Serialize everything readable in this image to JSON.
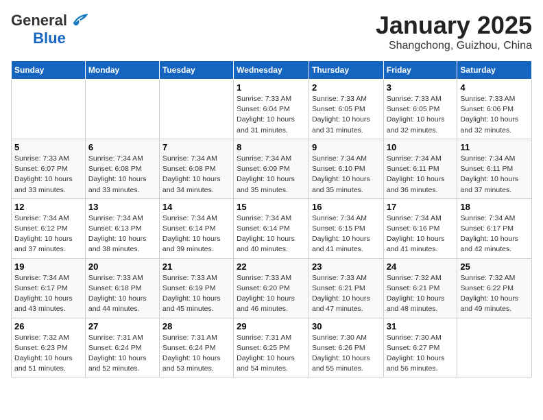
{
  "header": {
    "logo_general": "General",
    "logo_blue": "Blue",
    "month": "January 2025",
    "location": "Shangchong, Guizhou, China"
  },
  "days_of_week": [
    "Sunday",
    "Monday",
    "Tuesday",
    "Wednesday",
    "Thursday",
    "Friday",
    "Saturday"
  ],
  "weeks": [
    [
      {
        "day": "",
        "info": ""
      },
      {
        "day": "",
        "info": ""
      },
      {
        "day": "",
        "info": ""
      },
      {
        "day": "1",
        "info": "Sunrise: 7:33 AM\nSunset: 6:04 PM\nDaylight: 10 hours and 31 minutes."
      },
      {
        "day": "2",
        "info": "Sunrise: 7:33 AM\nSunset: 6:05 PM\nDaylight: 10 hours and 31 minutes."
      },
      {
        "day": "3",
        "info": "Sunrise: 7:33 AM\nSunset: 6:05 PM\nDaylight: 10 hours and 32 minutes."
      },
      {
        "day": "4",
        "info": "Sunrise: 7:33 AM\nSunset: 6:06 PM\nDaylight: 10 hours and 32 minutes."
      }
    ],
    [
      {
        "day": "5",
        "info": "Sunrise: 7:33 AM\nSunset: 6:07 PM\nDaylight: 10 hours and 33 minutes."
      },
      {
        "day": "6",
        "info": "Sunrise: 7:34 AM\nSunset: 6:08 PM\nDaylight: 10 hours and 33 minutes."
      },
      {
        "day": "7",
        "info": "Sunrise: 7:34 AM\nSunset: 6:08 PM\nDaylight: 10 hours and 34 minutes."
      },
      {
        "day": "8",
        "info": "Sunrise: 7:34 AM\nSunset: 6:09 PM\nDaylight: 10 hours and 35 minutes."
      },
      {
        "day": "9",
        "info": "Sunrise: 7:34 AM\nSunset: 6:10 PM\nDaylight: 10 hours and 35 minutes."
      },
      {
        "day": "10",
        "info": "Sunrise: 7:34 AM\nSunset: 6:11 PM\nDaylight: 10 hours and 36 minutes."
      },
      {
        "day": "11",
        "info": "Sunrise: 7:34 AM\nSunset: 6:11 PM\nDaylight: 10 hours and 37 minutes."
      }
    ],
    [
      {
        "day": "12",
        "info": "Sunrise: 7:34 AM\nSunset: 6:12 PM\nDaylight: 10 hours and 37 minutes."
      },
      {
        "day": "13",
        "info": "Sunrise: 7:34 AM\nSunset: 6:13 PM\nDaylight: 10 hours and 38 minutes."
      },
      {
        "day": "14",
        "info": "Sunrise: 7:34 AM\nSunset: 6:14 PM\nDaylight: 10 hours and 39 minutes."
      },
      {
        "day": "15",
        "info": "Sunrise: 7:34 AM\nSunset: 6:14 PM\nDaylight: 10 hours and 40 minutes."
      },
      {
        "day": "16",
        "info": "Sunrise: 7:34 AM\nSunset: 6:15 PM\nDaylight: 10 hours and 41 minutes."
      },
      {
        "day": "17",
        "info": "Sunrise: 7:34 AM\nSunset: 6:16 PM\nDaylight: 10 hours and 41 minutes."
      },
      {
        "day": "18",
        "info": "Sunrise: 7:34 AM\nSunset: 6:17 PM\nDaylight: 10 hours and 42 minutes."
      }
    ],
    [
      {
        "day": "19",
        "info": "Sunrise: 7:34 AM\nSunset: 6:17 PM\nDaylight: 10 hours and 43 minutes."
      },
      {
        "day": "20",
        "info": "Sunrise: 7:33 AM\nSunset: 6:18 PM\nDaylight: 10 hours and 44 minutes."
      },
      {
        "day": "21",
        "info": "Sunrise: 7:33 AM\nSunset: 6:19 PM\nDaylight: 10 hours and 45 minutes."
      },
      {
        "day": "22",
        "info": "Sunrise: 7:33 AM\nSunset: 6:20 PM\nDaylight: 10 hours and 46 minutes."
      },
      {
        "day": "23",
        "info": "Sunrise: 7:33 AM\nSunset: 6:21 PM\nDaylight: 10 hours and 47 minutes."
      },
      {
        "day": "24",
        "info": "Sunrise: 7:32 AM\nSunset: 6:21 PM\nDaylight: 10 hours and 48 minutes."
      },
      {
        "day": "25",
        "info": "Sunrise: 7:32 AM\nSunset: 6:22 PM\nDaylight: 10 hours and 49 minutes."
      }
    ],
    [
      {
        "day": "26",
        "info": "Sunrise: 7:32 AM\nSunset: 6:23 PM\nDaylight: 10 hours and 51 minutes."
      },
      {
        "day": "27",
        "info": "Sunrise: 7:31 AM\nSunset: 6:24 PM\nDaylight: 10 hours and 52 minutes."
      },
      {
        "day": "28",
        "info": "Sunrise: 7:31 AM\nSunset: 6:24 PM\nDaylight: 10 hours and 53 minutes."
      },
      {
        "day": "29",
        "info": "Sunrise: 7:31 AM\nSunset: 6:25 PM\nDaylight: 10 hours and 54 minutes."
      },
      {
        "day": "30",
        "info": "Sunrise: 7:30 AM\nSunset: 6:26 PM\nDaylight: 10 hours and 55 minutes."
      },
      {
        "day": "31",
        "info": "Sunrise: 7:30 AM\nSunset: 6:27 PM\nDaylight: 10 hours and 56 minutes."
      },
      {
        "day": "",
        "info": ""
      }
    ]
  ]
}
